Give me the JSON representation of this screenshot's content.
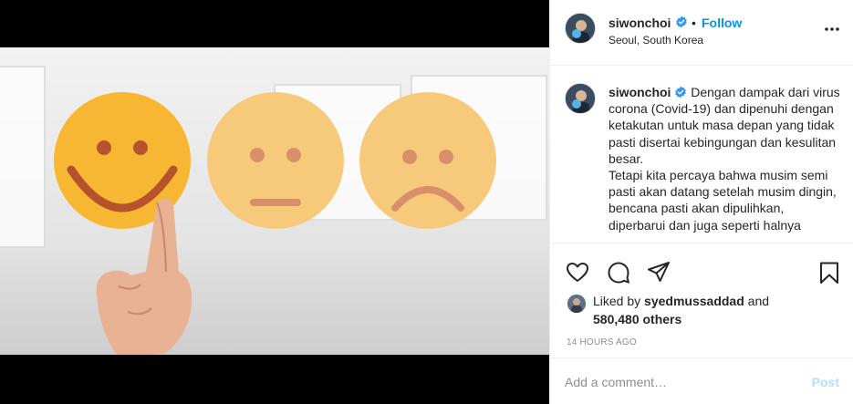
{
  "post": {
    "username": "siwonchoi",
    "follow_label": "Follow",
    "separator": "•",
    "location": "Seoul, South Korea",
    "caption": "Dengan dampak dari virus corona (Covid-19) dan dipenuhi dengan ketakutan untuk masa depan yang tidak pasti disertai kebingungan dan kesulitan besar.\nTetapi kita percaya bahwa musim semi pasti akan datang setelah musim dingin, bencana pasti akan dipulihkan, diperbarui dan juga seperti halnya",
    "liked_by_prefix": "Liked by",
    "liked_by_user": "syedmussaddad",
    "liked_by_and": "and",
    "others_count": "580,480 others",
    "timestamp": "14 hours ago",
    "comment_placeholder": "Add a comment…",
    "post_label": "Post"
  },
  "icons": {
    "verified": "verified-badge-icon",
    "more": "more-options-icon",
    "like": "heart-icon",
    "comment": "comment-bubble-icon",
    "share": "paper-plane-icon",
    "save": "bookmark-icon"
  },
  "colors": {
    "accent": "#0095f6",
    "post_disabled": "#b2dffc",
    "muted": "#8e8e8e",
    "text": "#262626"
  }
}
